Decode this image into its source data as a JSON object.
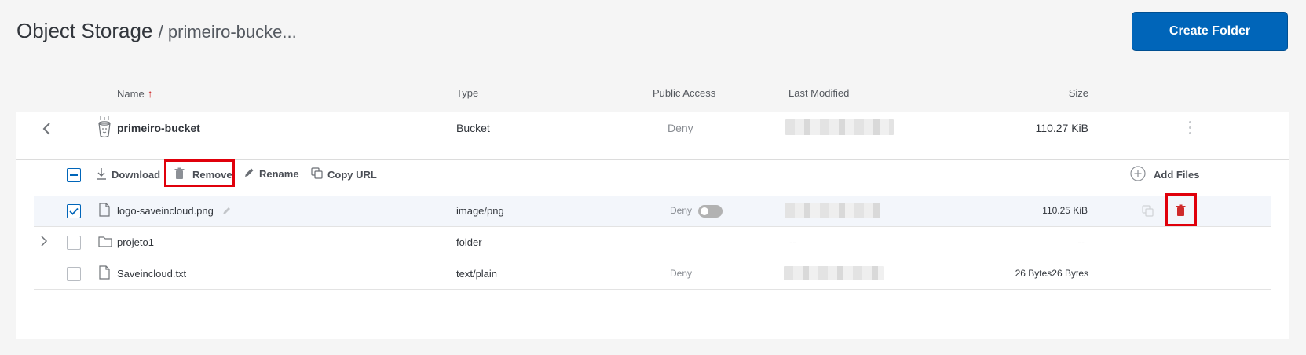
{
  "header": {
    "title": "Object Storage",
    "breadcrumb_suffix": "/ primeiro-bucke...",
    "create_folder_label": "Create Folder"
  },
  "columns": {
    "name": "Name",
    "name_sort_icon": "arrow-up-icon",
    "type": "Type",
    "public_access": "Public Access",
    "last_modified": "Last Modified",
    "size": "Size"
  },
  "bucket": {
    "name": "primeiro-bucket",
    "type": "Bucket",
    "public_access": "Deny",
    "size": "110.27 KiB"
  },
  "toolbar": {
    "download_label": "Download",
    "remove_label": "Remove",
    "rename_label": "Rename",
    "copy_url_label": "Copy URL",
    "add_files_label": "Add Files"
  },
  "files": [
    {
      "name": "logo-saveincloud.png",
      "type": "image/png",
      "public_access": "Deny",
      "public_toggle": "off",
      "last_modified": "",
      "size": "110.25 KiB",
      "checked": true
    },
    {
      "name": "projeto1",
      "type": "folder",
      "public_access": "",
      "last_modified": "--",
      "size": "--",
      "checked": false
    },
    {
      "name": "Saveincloud.txt",
      "type": "text/plain",
      "public_access": "Deny",
      "last_modified": "",
      "size": "26 Bytes26 Bytes",
      "checked": false
    }
  ],
  "colors": {
    "accent": "#0065b9",
    "danger": "#cf2b2b",
    "highlight_box": "#e0000b"
  }
}
